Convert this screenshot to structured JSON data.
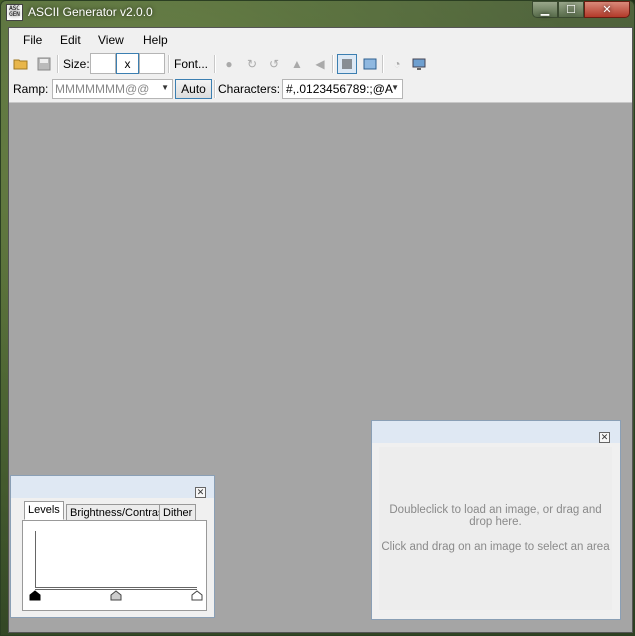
{
  "window": {
    "title": "ASCII Generator v2.0.0",
    "app_icon_text": "ASC GEN"
  },
  "menu": [
    "File",
    "Edit",
    "View",
    "Help"
  ],
  "toolbar": {
    "size_label": "Size:",
    "size_separator": "x",
    "font_button": "Font...",
    "icons": [
      "open-icon",
      "save-icon",
      "circle-icon",
      "rotate-cw-icon",
      "rotate-ccw-icon",
      "flip-h-icon",
      "flip-v-icon",
      "text-view-icon",
      "image-view-icon",
      "zoom-icon",
      "monitor-icon"
    ]
  },
  "ramp": {
    "label": "Ramp:",
    "value": "MMMMMMM@@",
    "auto_button": "Auto",
    "characters_label": "Characters:",
    "characters_value": "#,.0123456789:;@A"
  },
  "levels_panel": {
    "tabs": [
      "Levels",
      "Brightness/Contrast",
      "Dither"
    ],
    "active_tab": "Levels"
  },
  "preview_panel": {
    "hint1": "Doubleclick to load an image, or drag and drop here.",
    "hint2": "Click and drag on an image to select an area"
  }
}
